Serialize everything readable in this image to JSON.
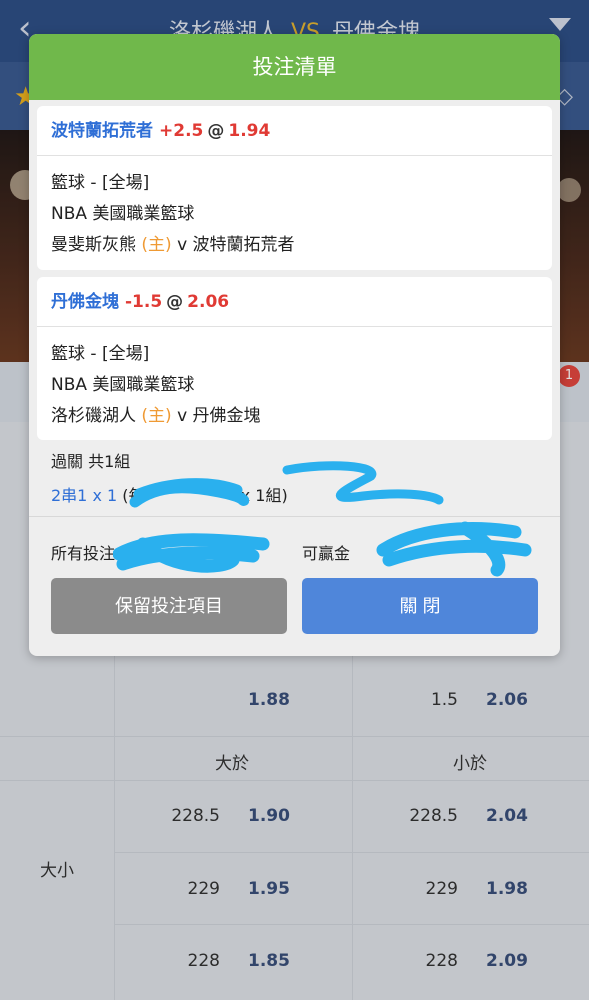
{
  "header": {
    "home_team": "洛杉磯湖人",
    "vs": "VS",
    "away_team": "丹佛金塊"
  },
  "notification_count": "1",
  "odds_table": {
    "top_row": {
      "left_odd": "1.88",
      "right_line": "1.5",
      "right_odd": "2.06"
    },
    "over_label": "大於",
    "under_label": "小於",
    "market_label": "大小",
    "rows": [
      {
        "over_line": "228.5",
        "over_odd": "1.90",
        "under_line": "228.5",
        "under_odd": "2.04"
      },
      {
        "over_line": "229",
        "over_odd": "1.95",
        "under_line": "229",
        "under_odd": "1.98"
      },
      {
        "over_line": "228",
        "over_odd": "1.85",
        "under_line": "228",
        "under_odd": "2.09"
      }
    ]
  },
  "modal": {
    "title": "投注清單",
    "bets": [
      {
        "team": "波特蘭拓荒者",
        "handicap": "+2.5",
        "at": "@",
        "odds": "1.94",
        "sport": "籃球 - [全場]",
        "league": "NBA 美國職業籃球",
        "home_team": "曼斐斯灰熊",
        "home_marker": "(主)",
        "v": "v",
        "away_team": "波特蘭拓荒者"
      },
      {
        "team": "丹佛金塊",
        "handicap": "-1.5",
        "at": "@",
        "odds": "2.06",
        "sport": "籃球 - [全場]",
        "league": "NBA 美國職業籃球",
        "home_team": "洛杉磯湖人",
        "home_marker": "(主)",
        "v": "v",
        "away_team": "丹佛金塊"
      }
    ],
    "parlay_summary": "過關 共1組",
    "parlay_type": "2串1 x 1",
    "parlay_detail_open": "(每",
    "parlay_detail_close": "x 1組)",
    "stake_label": "所有投注",
    "win_label": "可贏金",
    "keep_button": "保留投注項目",
    "close_button": "關 閉"
  }
}
